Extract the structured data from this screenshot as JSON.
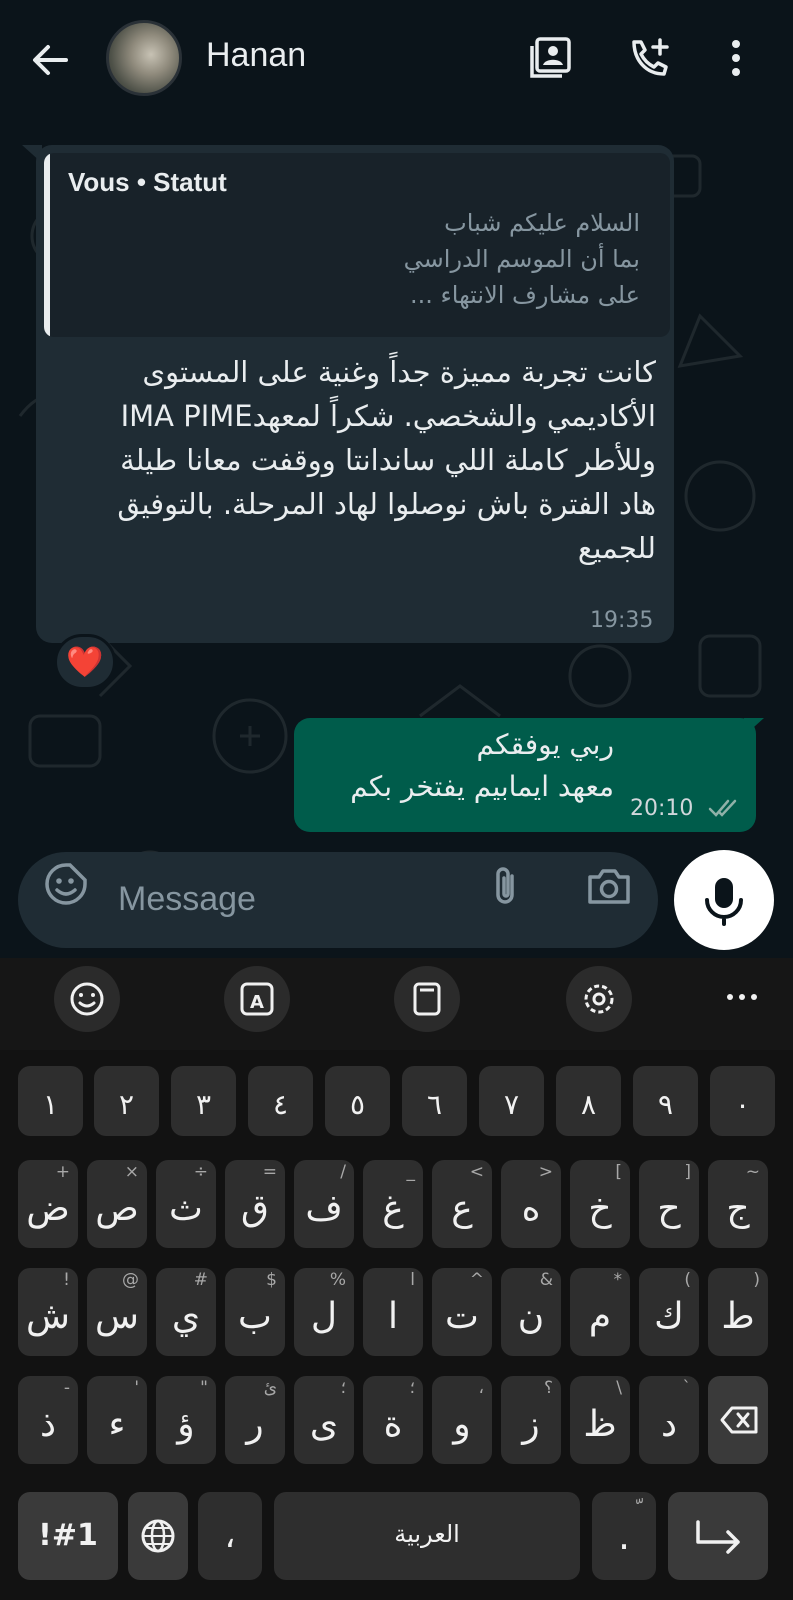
{
  "header": {
    "contact_name": "Hanan",
    "icons": [
      "back-arrow-icon",
      "contact-card-icon",
      "add-call-icon",
      "more-vert-icon"
    ]
  },
  "incoming": {
    "quote": {
      "author": "Vous • Statut",
      "lines": [
        "السلام عليكم شباب",
        "بما أن الموسم الدراسي",
        "على مشارف الانتهاء ..."
      ]
    },
    "text_lines": [
      "كانت تجربة مميزة جداً وغنية على المستوى",
      "الأكاديمي والشخصي. شكراً لمعهدIMA PIME",
      "وللأطر كاملة اللي ساندانتا ووقفت معانا طيلة",
      "هاد الفترة باش نوصلوا لهاد المرحلة. بالتوفيق",
      "للجميع"
    ],
    "time": "19:35",
    "reaction": "❤️"
  },
  "outgoing": {
    "text_lines": [
      "ربي يوفقكم",
      "معهد ايمابيم يفتخر بكم"
    ],
    "time": "20:10",
    "status_icon": "double-check-icon"
  },
  "composer": {
    "placeholder": "Message",
    "icons": [
      "sticker-icon",
      "attach-icon",
      "camera-icon",
      "mic-icon"
    ]
  },
  "keyboard": {
    "toolbar_icons": [
      "emoji-icon",
      "translate-icon",
      "clipboard-icon",
      "settings-icon",
      "more-horiz-icon"
    ],
    "number_row": [
      "١",
      "٢",
      "٣",
      "٤",
      "٥",
      "٦",
      "٧",
      "٨",
      "٩",
      "٠"
    ],
    "row1": [
      {
        "key": "ض",
        "hint": "+"
      },
      {
        "key": "ص",
        "hint": "×"
      },
      {
        "key": "ث",
        "hint": "÷"
      },
      {
        "key": "ق",
        "hint": "="
      },
      {
        "key": "ف",
        "hint": "/"
      },
      {
        "key": "غ",
        "hint": "_"
      },
      {
        "key": "ع",
        "hint": "<"
      },
      {
        "key": "ه",
        "hint": ">"
      },
      {
        "key": "خ",
        "hint": "["
      },
      {
        "key": "ح",
        "hint": "]"
      },
      {
        "key": "ج",
        "hint": "~"
      }
    ],
    "row2": [
      {
        "key": "ش",
        "hint": "!"
      },
      {
        "key": "س",
        "hint": "@"
      },
      {
        "key": "ي",
        "hint": "#"
      },
      {
        "key": "ب",
        "hint": "$"
      },
      {
        "key": "ل",
        "hint": "%"
      },
      {
        "key": "ا",
        "hint": "ا"
      },
      {
        "key": "ت",
        "hint": "^"
      },
      {
        "key": "ن",
        "hint": "&"
      },
      {
        "key": "م",
        "hint": "*"
      },
      {
        "key": "ك",
        "hint": "("
      },
      {
        "key": "ط",
        "hint": ")"
      }
    ],
    "row3": [
      {
        "key": "ذ",
        "hint": "-"
      },
      {
        "key": "ء",
        "hint": "'"
      },
      {
        "key": "ؤ",
        "hint": "\""
      },
      {
        "key": "ر",
        "hint": "ئ"
      },
      {
        "key": "ى",
        "hint": "؛"
      },
      {
        "key": "ة",
        "hint": "؛"
      },
      {
        "key": "و",
        "hint": "،"
      },
      {
        "key": "ز",
        "hint": "؟"
      },
      {
        "key": "ظ",
        "hint": "\\"
      },
      {
        "key": "د",
        "hint": "`"
      }
    ],
    "symbols_label": "!#1",
    "comma_label": "،",
    "space_label": "العربية",
    "period_label": ".",
    "period_hint": "ّ",
    "globe_icon": "globe-icon",
    "backspace_icon": "backspace-icon",
    "enter_icon": "enter-icon"
  }
}
